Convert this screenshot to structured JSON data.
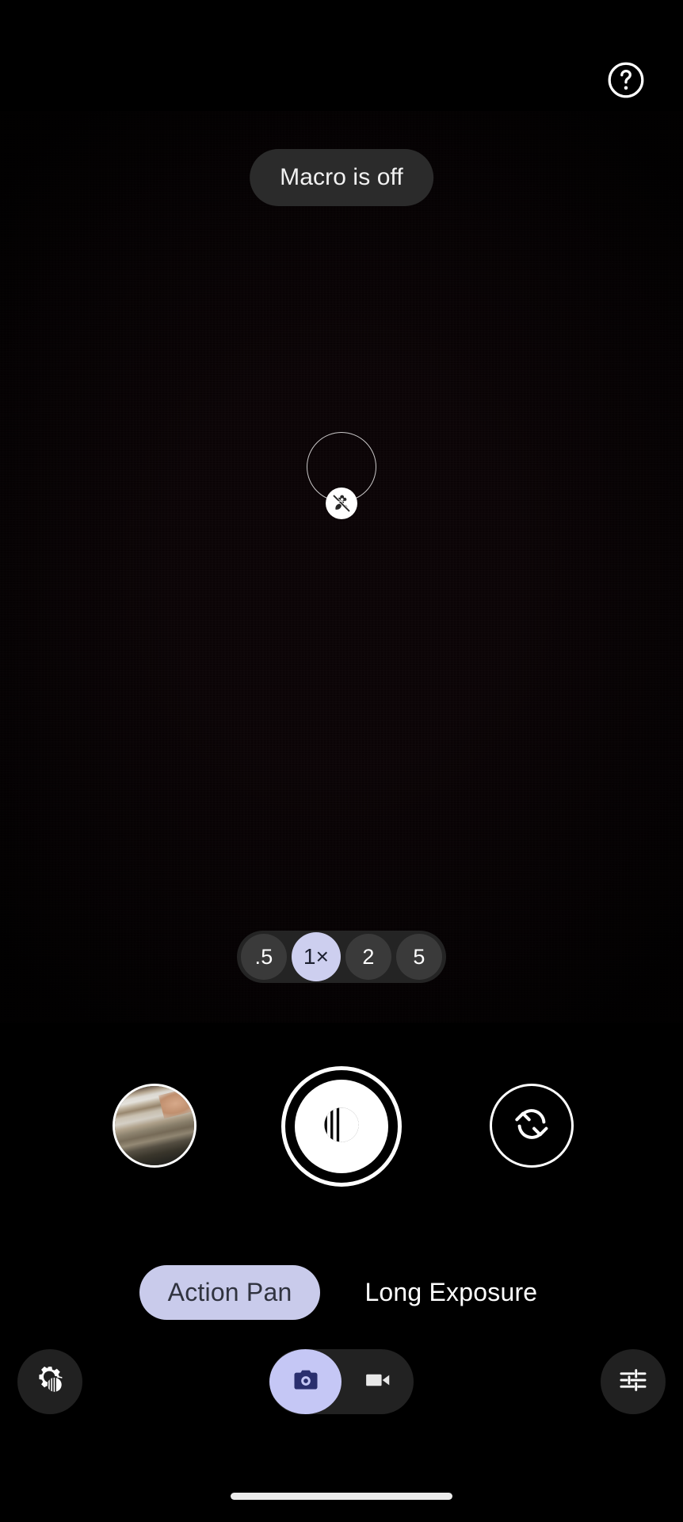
{
  "app": {
    "name": "Camera",
    "mode_active": "Action Pan"
  },
  "topbar": {
    "help_icon": "help-circle-icon",
    "help_label": "Help"
  },
  "viewfinder": {
    "toast_text": "Macro is off",
    "macro_badge_icon": "macro-off-flower-icon",
    "focus_ring": "focus-ring",
    "preview_colors": {
      "center": "#4a1117",
      "mid": "#2a0a0e",
      "edge": "#0d0305"
    }
  },
  "zoom": {
    "options": [
      {
        "label": ".5",
        "value": "0.5",
        "selected": false
      },
      {
        "label": "1×",
        "value": "1",
        "selected": true
      },
      {
        "label": "2",
        "value": "2",
        "selected": false
      },
      {
        "label": "5",
        "value": "5",
        "selected": false
      }
    ],
    "selected_label": "1×",
    "active_color": "#cdcfef"
  },
  "controls": {
    "gallery_label": "Gallery thumbnail",
    "gallery_icon": "gallery-thumbnail",
    "shutter_label": "Shutter",
    "shutter_icon": "action-pan-shutter-icon",
    "flip_label": "Switch camera",
    "flip_icon": "camera-flip-icon"
  },
  "modes": {
    "items": [
      {
        "label": "Action Pan",
        "selected": true
      },
      {
        "label": "Long Exposure",
        "selected": false
      }
    ],
    "selected_color": "#c9cbeb",
    "selected_text_color": "#30333f"
  },
  "toolbar": {
    "settings_label": "Settings",
    "settings_icon": "motion-settings-gear-icon",
    "photo_label": "Photo",
    "photo_icon": "camera-icon",
    "video_label": "Video",
    "video_icon": "video-camera-icon",
    "photo_selected": true,
    "tune_label": "Adjust",
    "tune_icon": "tune-sliders-icon",
    "accent_color": "#c5c7f5"
  },
  "system": {
    "home_indicator": "home-indicator"
  }
}
